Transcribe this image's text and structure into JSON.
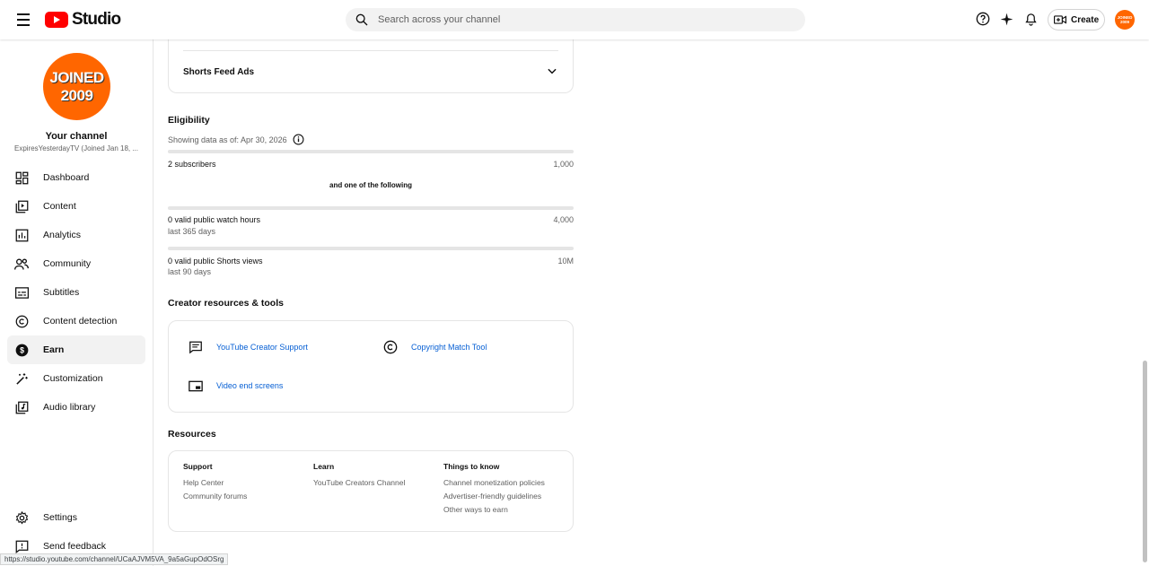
{
  "header": {
    "logo_text": "Studio",
    "search_placeholder": "Search across your channel",
    "create_label": "Create",
    "avatar_text": "JOINED 2009"
  },
  "sidebar": {
    "avatar_line1": "JOINED",
    "avatar_line2": "2009",
    "title": "Your channel",
    "subtitle": "ExpiresYesterdayTV (Joined Jan 18, ...",
    "items": [
      {
        "label": "Dashboard",
        "icon": "dashboard-icon"
      },
      {
        "label": "Content",
        "icon": "content-icon"
      },
      {
        "label": "Analytics",
        "icon": "analytics-icon"
      },
      {
        "label": "Community",
        "icon": "community-icon"
      },
      {
        "label": "Subtitles",
        "icon": "subtitles-icon"
      },
      {
        "label": "Content detection",
        "icon": "copyright-icon"
      },
      {
        "label": "Earn",
        "icon": "dollar-icon",
        "active": true
      },
      {
        "label": "Customization",
        "icon": "magic-wand-icon"
      },
      {
        "label": "Audio library",
        "icon": "audio-library-icon"
      }
    ],
    "settings_label": "Settings",
    "feedback_label": "Send feedback"
  },
  "main": {
    "shorts_feed_ads": "Shorts Feed Ads",
    "eligibility": {
      "title": "Eligibility",
      "data_as_of": "Showing data as of: Apr 30, 2026",
      "subscribers_label": "2 subscribers",
      "subscribers_target": "1,000",
      "subscribers_progress": 0.002,
      "and_one": "and one of the following",
      "watch_hours_label": "0 valid public watch hours",
      "watch_hours_period": "last 365 days",
      "watch_hours_target": "4,000",
      "watch_hours_progress": 0,
      "shorts_label": "0 valid public Shorts views",
      "shorts_period": "last 90 days",
      "shorts_target": "10M",
      "shorts_progress": 0
    },
    "tools": {
      "title": "Creator resources & tools",
      "creator_support": "YouTube Creator Support",
      "copyright_match": "Copyright Match Tool",
      "end_screens": "Video end screens"
    },
    "resources": {
      "title": "Resources",
      "support": {
        "heading": "Support",
        "links": [
          "Help Center",
          "Community forums"
        ]
      },
      "learn": {
        "heading": "Learn",
        "links": [
          "YouTube Creators Channel"
        ]
      },
      "things": {
        "heading": "Things to know",
        "links": [
          "Channel monetization policies",
          "Advertiser-friendly guidelines",
          "Other ways to earn"
        ]
      }
    }
  },
  "status_url": "https://studio.youtube.com/channel/UCaAJVM5VA_9a5aGupOdOSrg"
}
